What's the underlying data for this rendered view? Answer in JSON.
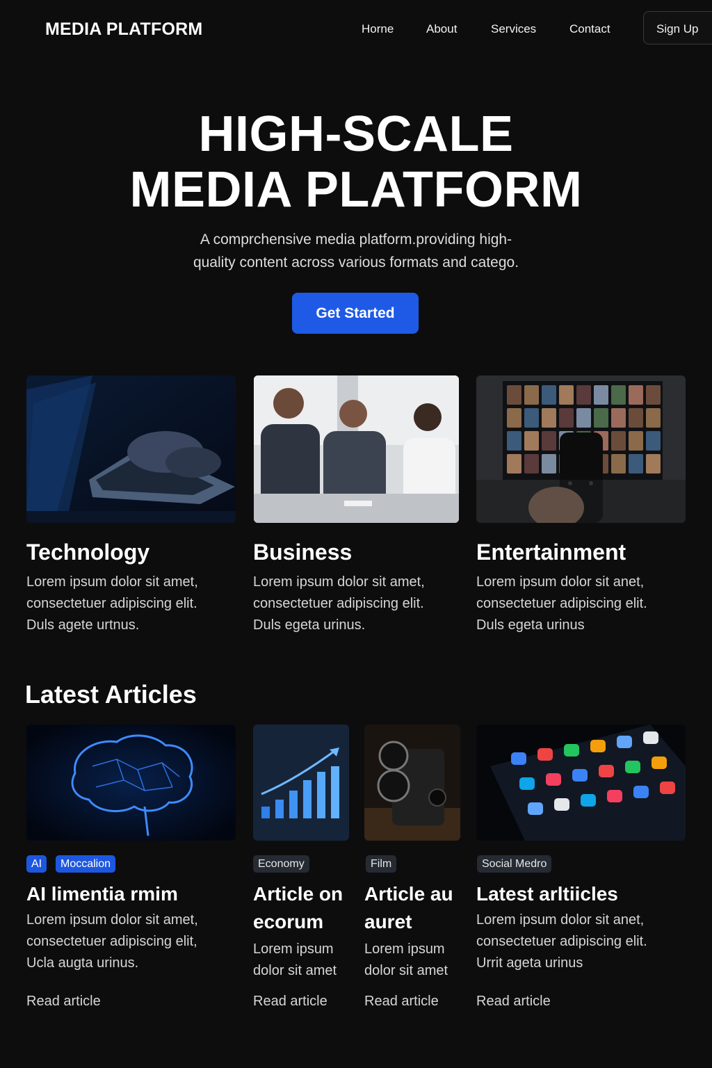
{
  "nav": {
    "brand": "MEDIA PLATFORM",
    "links": [
      "Horne",
      "About",
      "Services",
      "Contact"
    ],
    "signup_label": "Sign Up"
  },
  "hero": {
    "title_line1": "HIGH-SCALE",
    "title_line2": "MEDIA PLATFORM",
    "subtitle_line1": "A comprchensive media platform.providing high-",
    "subtitle_line2": "quality content across various formats and catego.",
    "cta_label": "Get Started"
  },
  "categories": [
    {
      "title": "Technology",
      "image": "laptop-typing-image",
      "desc": [
        "Lorem ipsum dolor sit amet,",
        "consectetuer adipiscing elit.",
        "Duls agete urtnus."
      ]
    },
    {
      "title": "Business",
      "image": "business-meeting-image",
      "desc": [
        "Lorem ipsum dolor sit amet,",
        "consectetuer adipiscing elit.",
        "Duls egeta urinus."
      ]
    },
    {
      "title": "Entertainment",
      "image": "tv-remote-image",
      "desc": [
        "Lorem ipsum dolor sit anet,",
        "consectetuer adipiscing elit.",
        "Duls egeta urinus"
      ]
    }
  ],
  "latest": {
    "section_title": "Latest Articles",
    "articles": [
      {
        "tags": [
          "AI",
          "Moccalion"
        ],
        "title": [
          "AI limentia rmim"
        ],
        "desc": [
          "Lorem ipsum dolor sit amet,",
          "consectetuer adipiscing elit,",
          "Ucla augta urinus."
        ],
        "read_label": "Read article",
        "image": "glowing-brain-image"
      },
      {
        "tags": [
          "Economy"
        ],
        "title": [
          "Article on",
          "ecorum"
        ],
        "desc": [
          "Lorem ipsum",
          "dolor sit amet"
        ],
        "read_label": "Read article",
        "image": "growth-chart-image"
      },
      {
        "tags": [
          "Film"
        ],
        "title": [
          "Article au",
          "auret"
        ],
        "desc": [
          "Lorem ipsum",
          "dolor sit amet"
        ],
        "read_label": "Read article",
        "image": "film-camera-image"
      },
      {
        "tags": [
          "Social Medro"
        ],
        "title": [
          "Latest arltiicles"
        ],
        "desc": [
          "Lorem ipsum dolor sit anet,",
          "consectetuer adipiscing elit.",
          "Urrit ageta urinus"
        ],
        "read_label": "Read article",
        "image": "smartphone-apps-image"
      }
    ]
  },
  "colors": {
    "background": "#0d0d0e",
    "accent": "#1e5ae6",
    "tag_gray": "#252a33"
  }
}
